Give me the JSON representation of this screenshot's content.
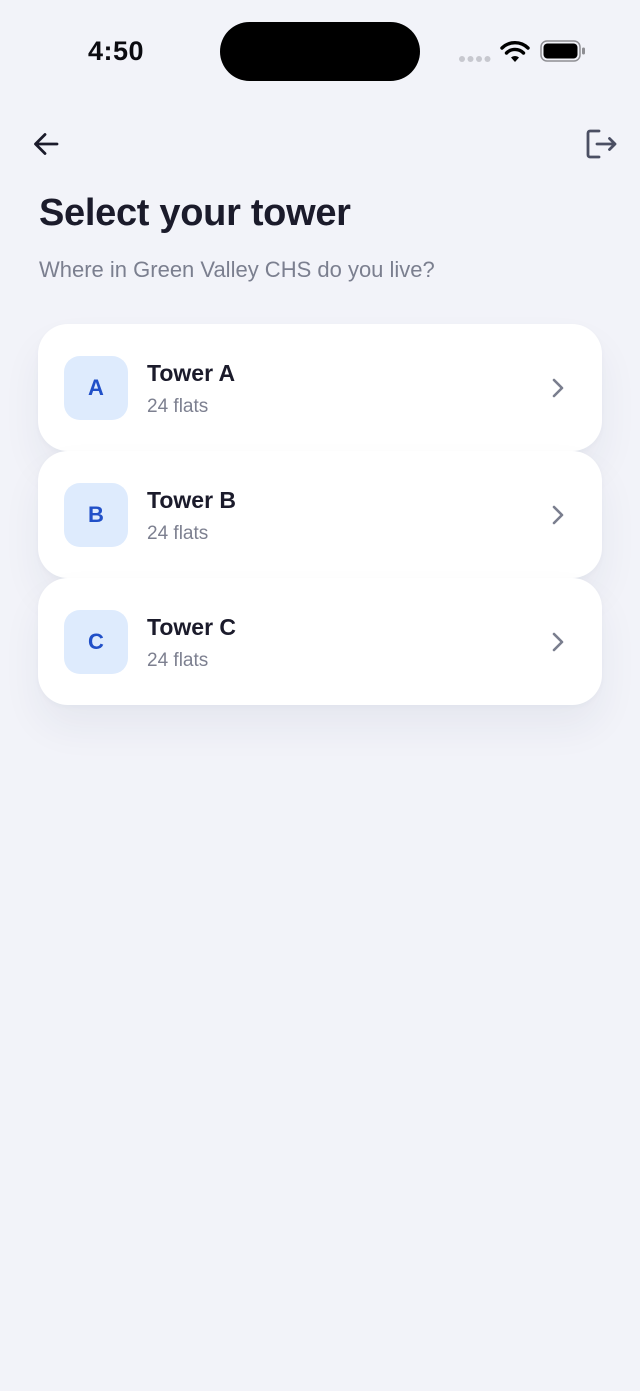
{
  "status_bar": {
    "time": "4:50",
    "icons": [
      "cellular-signal-icon",
      "wifi-icon",
      "battery-icon"
    ]
  },
  "nav": {
    "back_icon": "arrow-left-icon",
    "logout_icon": "logout-icon"
  },
  "header": {
    "title": "Select your tower",
    "subtitle": "Where in Green Valley CHS do you live?"
  },
  "towers": [
    {
      "letter": "A",
      "name": "Tower A",
      "flats": "24 flats"
    },
    {
      "letter": "B",
      "name": "Tower B",
      "flats": "24 flats"
    },
    {
      "letter": "C",
      "name": "Tower C",
      "flats": "24 flats"
    }
  ],
  "colors": {
    "background": "#f2f3f9",
    "card": "#ffffff",
    "badge_bg": "#deebfd",
    "badge_text": "#2150c8",
    "title_text": "#1b1b2b",
    "muted_text": "#7b7f8f"
  }
}
